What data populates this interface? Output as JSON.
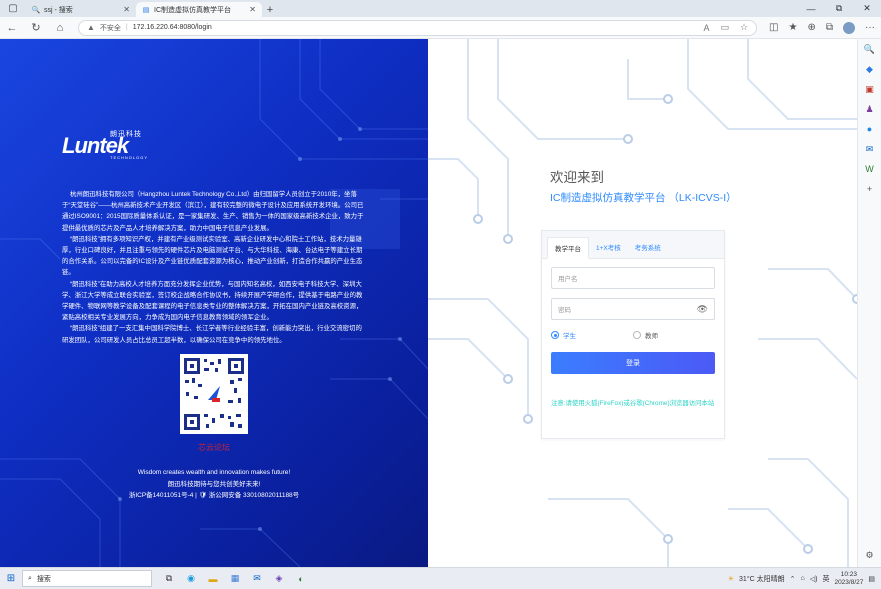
{
  "browser": {
    "tabs": [
      {
        "title": "ssj - 搜索",
        "icon": "search-icon"
      },
      {
        "title": "IC制造虚拟仿真教学平台",
        "icon": "page-icon"
      }
    ],
    "new_tab": "+",
    "window_controls": [
      "—",
      "⧉",
      "✕"
    ],
    "security_label": "不安全",
    "url": "172.16.220.64:8080/login"
  },
  "brand": {
    "cn_name": "朗迅科技",
    "logo_word": "Luntek",
    "logo_sub": "TECHNOLOGY"
  },
  "intro_paragraphs": [
    "杭州朗迅科技有限公司（Hangzhou Luntek Technology Co.,Ltd）由归国留学人员创立于2010年，坐落于“天堂硅谷”——杭州高新技术产业开发区（滨江），建有较完整的微电子设计及应用系统开发环境。公司已通过ISO9001：2015国际质量体系认证，是一家集研发、生产、销售为一体的国家级高新技术企业，致力于提供最优质的芯片及产品人才培养解决方案，助力中国电子信息产业发展。",
    "“朗迅科技”拥有多项知识产权，并建有产业级测试实验室、高新企业研发中心和院士工作站，技术力量雄厚，行业口碑良好，并且注重与领先的硬件芯片及电脑测试平台、与大华科技、海康、台达电子等建立长期的合作关系。公司以完备的IC设计及产业链优质配套资源为核心，推动产业创新，打造合作共赢的产业生态链。",
    "“朗迅科技”在助力高校人才培养方面充分发挥企业优势，与国内知名高校，如西安电子科技大学、深圳大学、浙江大学等成立联合实验室，签订校企战略合作协议书，持续开展产学研合作，提供基于电路产业的教学硬件、物联网等教学设备及配套课程的电子信息类专业的整体解决方案，开拓在国内产业链及高校资源，紧贴高校相关专业发展方向，力争成为国内电子信息教育领域的领军企业。",
    "“朗迅科技”组建了一支汇集中国科学院博士、长江学者等行业经验丰富，创新能力突出，行业交流密切的研发团队，公司研发人员占比总员工超半数，以确保公司在竞争中的领先地位。"
  ],
  "qr_caption": "芯云论坛",
  "slogan": [
    "Wisdom creates wealth and innovation makes future!",
    "朗迅科技期待与您共创美好未来!",
    "浙ICP备14011051号-4 | 🛡 浙公网安备 33010802011188号"
  ],
  "login": {
    "welcome": "欢迎来到",
    "platform": "IC制造虚拟仿真教学平台 （LK-ICVS-I）",
    "tabs": [
      "教学平台",
      "1+X考核",
      "考务系统"
    ],
    "username_placeholder": "用户名",
    "password_placeholder": "密码",
    "roles": [
      "学生",
      "教师"
    ],
    "selected_role": "学生",
    "submit": "登录",
    "tip": "注意:请使用火狐(FireFox)或谷歌(Chrome)浏览器访问本站"
  },
  "taskbar": {
    "search_placeholder": "搜索",
    "weather": "31°C 太阳晴朗",
    "ime": "英",
    "time": "10:23",
    "date": "2023/8/27"
  },
  "colors": {
    "left_panel": "#1a46e0",
    "accent": "#2e8bff",
    "button": "#4b5af5",
    "tip": "#2cd3c6",
    "qr_caption": "#c4243a"
  }
}
